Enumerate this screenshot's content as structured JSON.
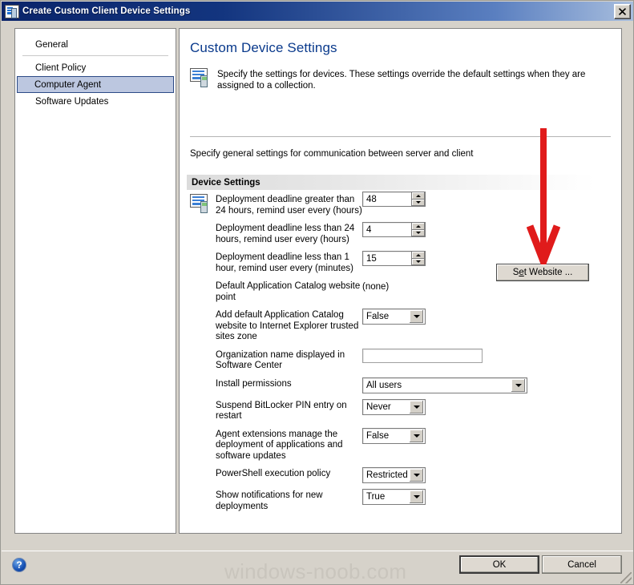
{
  "window": {
    "title": "Create Custom Client Device Settings",
    "icon": "client-settings-icon",
    "close_label": "✕"
  },
  "sidebar": {
    "items": [
      {
        "label": "General",
        "selected": false
      },
      {
        "label": "Client Policy",
        "selected": false
      },
      {
        "label": "Computer Agent",
        "selected": true
      },
      {
        "label": "Software Updates",
        "selected": false
      }
    ]
  },
  "page": {
    "title": "Custom Device Settings",
    "description": "Specify the settings for devices. These settings override the default settings when they are assigned to a collection.",
    "sub_description": "Specify general settings for communication between server and client",
    "section_header": "Device Settings"
  },
  "settings": [
    {
      "label": "Deployment deadline greater than 24 hours, remind user every (hours)",
      "control": "spinner",
      "value": "48"
    },
    {
      "label": "Deployment deadline less than 24 hours, remind user every (hours)",
      "control": "spinner",
      "value": "4"
    },
    {
      "label": "Deployment deadline less than 1 hour, remind user every (minutes)",
      "control": "spinner",
      "value": "15"
    },
    {
      "label": "Default Application Catalog website point",
      "control": "text",
      "value": "(none)"
    },
    {
      "label": "Add default Application Catalog website to Internet Explorer trusted sites zone",
      "control": "combo-small",
      "value": "False"
    },
    {
      "label": "Organization name displayed in Software Center",
      "control": "input",
      "value": ""
    },
    {
      "label": "Install permissions",
      "control": "combo-wide",
      "value": "All users"
    },
    {
      "label": "Suspend BitLocker PIN entry on restart",
      "control": "combo-small",
      "value": "Never"
    },
    {
      "label": "Agent extensions manage the deployment of applications and software updates",
      "control": "combo-small",
      "value": "False"
    },
    {
      "label": "PowerShell execution policy",
      "control": "combo-small",
      "value": "Restricted"
    },
    {
      "label": "Show notifications for new deployments",
      "control": "combo-small",
      "value": "True"
    }
  ],
  "set_website_button": {
    "prefix": "S",
    "accel": "e",
    "suffix": "t Website ..."
  },
  "annotation": {
    "type": "red-down-arrow",
    "color": "#e01b1b"
  },
  "footer": {
    "help_label": "?",
    "watermark": "windows-noob.com",
    "ok_label": "OK",
    "cancel_label": "Cancel"
  }
}
